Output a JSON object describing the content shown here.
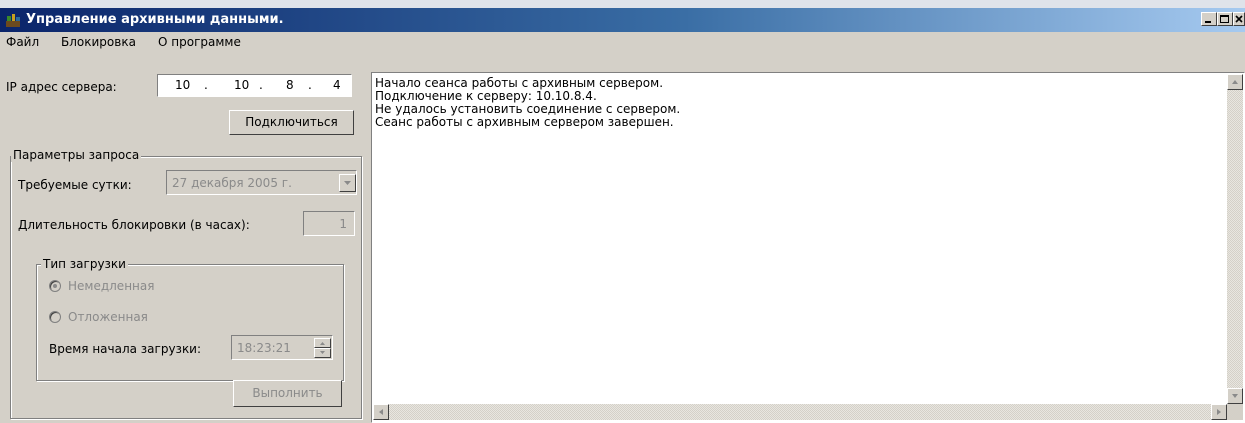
{
  "window": {
    "title": "Управление архивными данными."
  },
  "menu": [
    {
      "label": "Файл"
    },
    {
      "label": "Блокировка"
    },
    {
      "label": "О программе"
    }
  ],
  "server": {
    "ip_label": "IP адрес сервера:",
    "ip_octets": [
      "10",
      "10",
      "8",
      "4"
    ],
    "ip_dot": ".",
    "connect_button": "Подключиться"
  },
  "params": {
    "legend": "Параметры запроса",
    "day_label": "Требуемые сутки:",
    "day_value": "27 декабря 2005 г.",
    "lock_label": "Длительность блокировки (в часах):",
    "lock_value": "1",
    "load_type": {
      "legend": "Тип загрузки",
      "option_immediate": "Немедленная",
      "option_deferred": "Отложенная",
      "selected": "Немедленная",
      "start_time_label": "Время начала загрузки:",
      "start_time_value": "18:23:21"
    },
    "execute_button": "Выполнить"
  },
  "log": {
    "lines": [
      "Начало сеанса работы с архивным сервером.",
      "Подключение к серверу: 10.10.8.4.",
      "Не удалось установить соединение с сервером.",
      "Сеанс работы с архивным сервером завершен."
    ]
  },
  "icons": {
    "app": "app-icon",
    "minimize": "minimize-icon",
    "maximize": "maximize-icon",
    "close": "close-icon",
    "dropdown": "chevron-down-icon",
    "spin_up": "spin-up-icon",
    "spin_down": "spin-down-icon",
    "scroll_up": "scroll-up-icon",
    "scroll_down": "scroll-down-icon",
    "scroll_left": "scroll-left-icon",
    "scroll_right": "scroll-right-icon"
  },
  "colors": {
    "title_start": "#0a246a",
    "title_end": "#a6caf0",
    "face": "#d4d0c8",
    "disabled_text": "#8a8a8a"
  }
}
